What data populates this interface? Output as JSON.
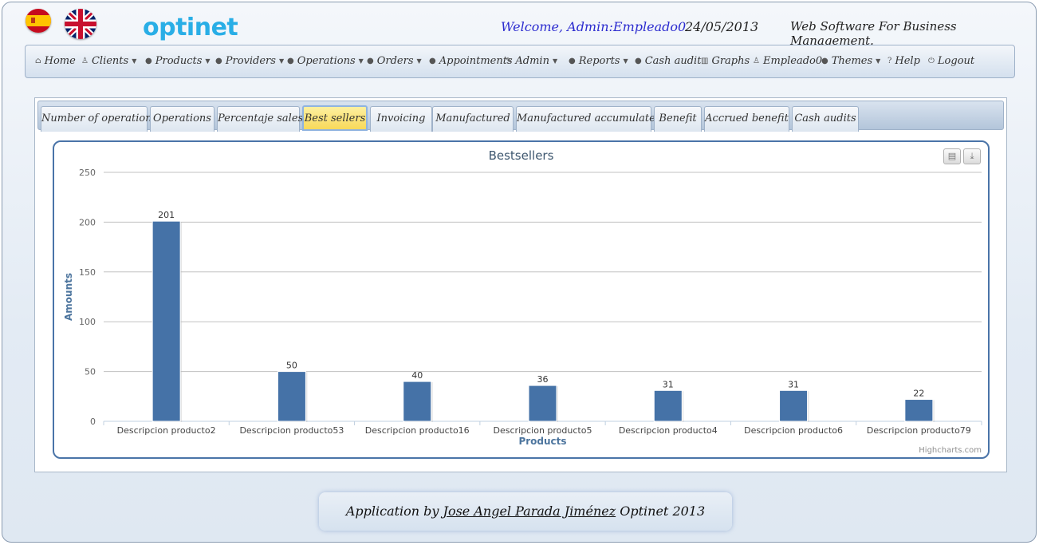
{
  "header": {
    "logo": "optinet",
    "welcome": "Welcome, Admin:Empleado0",
    "date": "24/05/2013",
    "tagline": "Web Software For Business Management."
  },
  "menu": [
    {
      "label": "Home",
      "icon": "home-icon",
      "glyph": "⌂",
      "caret": false
    },
    {
      "label": "Clients",
      "icon": "user-icon",
      "glyph": "♙",
      "caret": true
    },
    {
      "label": "Products",
      "icon": "bullet-icon",
      "glyph": "●",
      "caret": true
    },
    {
      "label": "Providers",
      "icon": "bullet-icon",
      "glyph": "●",
      "caret": true
    },
    {
      "label": "Operations",
      "icon": "bullet-icon",
      "glyph": "●",
      "caret": true
    },
    {
      "label": "Orders",
      "icon": "bullet-icon",
      "glyph": "●",
      "caret": true
    },
    {
      "label": "Appointments",
      "icon": "bullet-icon",
      "glyph": "●",
      "caret": false
    },
    {
      "label": "Admin",
      "icon": "wrench-icon",
      "glyph": "✎",
      "caret": true
    },
    {
      "label": "Reports",
      "icon": "bullet-icon",
      "glyph": "●",
      "caret": true
    },
    {
      "label": "Cash audit",
      "icon": "bullet-icon",
      "glyph": "●",
      "caret": false
    },
    {
      "label": "Graphs",
      "icon": "chart-icon",
      "glyph": "▥",
      "caret": false
    },
    {
      "label": "Empleado0",
      "icon": "user-icon",
      "glyph": "♙",
      "caret": false
    },
    {
      "label": "Themes",
      "icon": "bullet-icon",
      "glyph": "●",
      "caret": true
    },
    {
      "label": "Help",
      "icon": "question-icon",
      "glyph": "?",
      "caret": false
    },
    {
      "label": "Logout",
      "icon": "power-icon",
      "glyph": "⏻",
      "caret": false
    }
  ],
  "tabs": [
    {
      "label": "Number of operations",
      "active": false
    },
    {
      "label": "Operations",
      "active": false
    },
    {
      "label": "Percentaje sales",
      "active": false
    },
    {
      "label": "Best sellers",
      "active": true
    },
    {
      "label": "Invoicing",
      "active": false
    },
    {
      "label": "Manufactured",
      "active": false
    },
    {
      "label": "Manufactured accumulated",
      "active": false
    },
    {
      "label": "Benefit",
      "active": false
    },
    {
      "label": "Accrued benefit",
      "active": false
    },
    {
      "label": "Cash audits",
      "active": false
    }
  ],
  "chart_data": {
    "type": "bar",
    "title": "Bestsellers",
    "xlabel": "Products",
    "ylabel": "Amounts",
    "categories": [
      "Descripcion producto2",
      "Descripcion producto53",
      "Descripcion producto16",
      "Descripcion producto5",
      "Descripcion producto4",
      "Descripcion producto6",
      "Descripcion producto79"
    ],
    "values": [
      201,
      50,
      40,
      36,
      31,
      31,
      22
    ],
    "data_labels": [
      "201",
      "50",
      "40",
      "36",
      "31",
      "31",
      "22"
    ],
    "ylim": [
      0,
      250
    ],
    "yticks": [
      0,
      50,
      100,
      150,
      200,
      250
    ],
    "bar_color": "#4572a7",
    "grid": true,
    "credits": "Highcharts.com"
  },
  "footer": {
    "prefix": "Application by",
    "author": "Jose Angel Parada Jiménez",
    "suffix": "Optinet 2013"
  },
  "colors": {
    "accent": "#29aee6",
    "welcome": "#2c2ccf",
    "active_tab": "#f8d95a"
  }
}
